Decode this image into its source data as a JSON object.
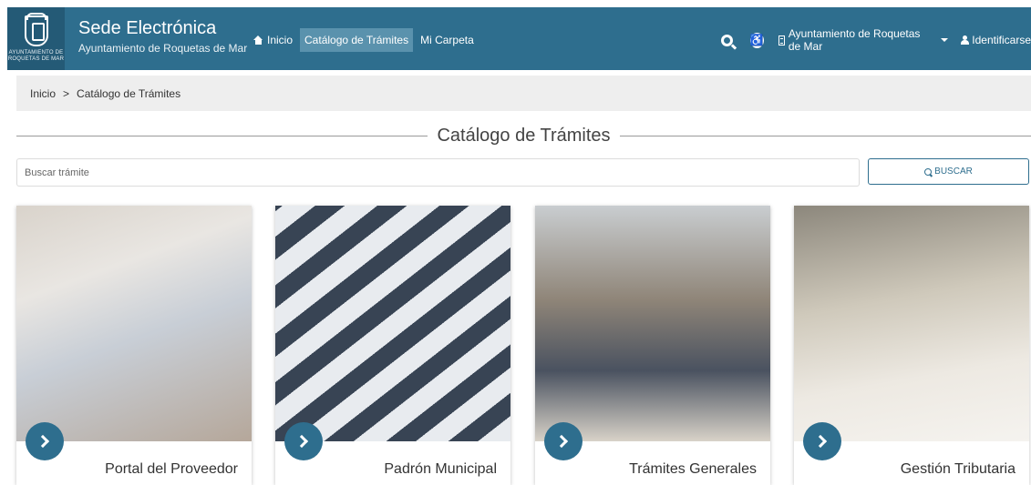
{
  "header": {
    "logo_text": "Ayuntamiento de Roquetas de Mar",
    "title": "Sede Electrónica",
    "subtitle": "Ayuntamiento de Roquetas de Mar",
    "nav": [
      {
        "label": "Inicio",
        "icon": "home-icon",
        "active": false
      },
      {
        "label": "Catálogo de Trámites",
        "active": true
      },
      {
        "label": "Mi Carpeta",
        "active": false
      }
    ],
    "org_selector": "Ayuntamiento de Roquetas de Mar",
    "login_label": "Identificarse"
  },
  "breadcrumb": {
    "home": "Inicio",
    "separator": ">",
    "current": "Catálogo de Trámites"
  },
  "main": {
    "heading": "Catálogo de Trámites",
    "search": {
      "placeholder": "Buscar trámite",
      "button_label": "BUSCAR"
    },
    "cards": [
      {
        "label": "Portal del Proveedor"
      },
      {
        "label": "Padrón Municipal"
      },
      {
        "label": "Trámites Generales"
      },
      {
        "label": "Gestión Tributaria"
      }
    ]
  },
  "colors": {
    "brand": "#2e6e8e",
    "nav_active": "#5a92ad",
    "breadcrumb_bg": "#eeeeee"
  }
}
